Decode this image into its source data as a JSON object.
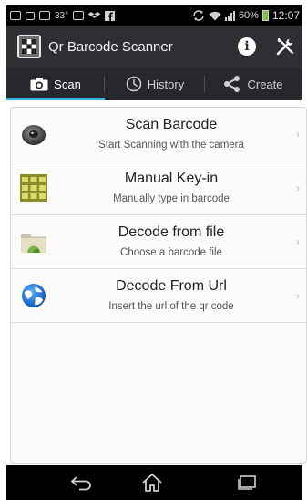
{
  "status_bar": {
    "temperature": "33°",
    "battery_text": "60%",
    "time": "12:07",
    "icons": [
      "gallery-icon",
      "voicemail-icon",
      "message-icon",
      "mail-icon",
      "dropbox-icon",
      "facebook-icon",
      "sync-icon",
      "wifi-icon",
      "signal-icon",
      "battery-icon"
    ],
    "battery_level": 0.6
  },
  "app_bar": {
    "title": "Qr Barcode Scanner",
    "info_label": "i",
    "icons": [
      "app-logo-icon",
      "info-icon",
      "tools-icon"
    ]
  },
  "tabs": [
    {
      "label": "Scan",
      "icon": "camera-icon",
      "active": true
    },
    {
      "label": "History",
      "icon": "clock-icon",
      "active": false
    },
    {
      "label": "Create",
      "icon": "share-icon",
      "active": false
    }
  ],
  "menu": {
    "items": [
      {
        "title": "Scan Barcode",
        "subtitle": "Start Scanning with the camera",
        "icon": "camera-lens-icon"
      },
      {
        "title": "Manual Key-in",
        "subtitle": "Manually type in barcode",
        "icon": "keypad-icon"
      },
      {
        "title": "Decode from file",
        "subtitle": "Choose a barcode file",
        "icon": "folder-icon"
      },
      {
        "title": "Decode From Url",
        "subtitle": "Insert the url of the qr code",
        "icon": "globe-icon"
      }
    ],
    "chevron": "›"
  },
  "nav_bar": {
    "icons": [
      "back-icon",
      "home-icon",
      "recent-apps-icon"
    ]
  },
  "colors": {
    "action_bar": "#2d2f33",
    "tab_bar": "#26282b",
    "tab_indicator": "#33b5e5",
    "list_background": "#fbfbfb"
  }
}
